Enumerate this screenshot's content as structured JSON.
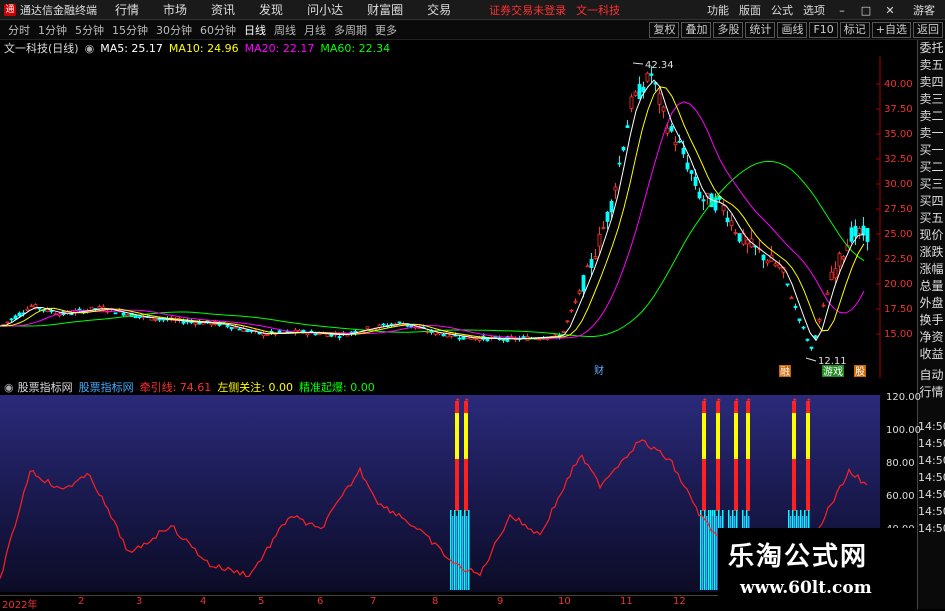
{
  "titlebar": {
    "app_title": "通达信金融终端",
    "menu": [
      "行情",
      "市场",
      "资讯",
      "发现",
      "问小达",
      "财富圈",
      "交易"
    ],
    "notice": "证券交易未登录",
    "stock_name": "文一科技",
    "right_menu": [
      "功能",
      "版面",
      "公式",
      "选项"
    ],
    "guest": "游客"
  },
  "periods": [
    "分时",
    "1分钟",
    "5分钟",
    "15分钟",
    "30分钟",
    "60分钟",
    "日线",
    "周线",
    "月线",
    "多周期",
    "更多"
  ],
  "active_period": "日线",
  "toolbar": [
    "复权",
    "叠加",
    "多股",
    "统计",
    "画线",
    "F10",
    "标记",
    "+自选",
    "返回"
  ],
  "ma": {
    "label": "文一科技(日线)",
    "ma5": "MA5: 25.17",
    "ma10": "MA10: 24.96",
    "ma20": "MA20: 22.17",
    "ma60": "MA60: 22.34"
  },
  "price_axis": [
    "40.00",
    "37.50",
    "35.00",
    "32.50",
    "30.00",
    "27.50",
    "25.00",
    "22.50",
    "20.00",
    "17.50",
    "15.00"
  ],
  "annotations": {
    "high": "42.34",
    "low": "12.11",
    "tags": [
      "财",
      "融",
      "游戏",
      "股"
    ]
  },
  "side_panel": [
    "委托",
    "卖五",
    "卖四",
    "卖三",
    "卖二",
    "卖一",
    "买一",
    "买二",
    "买三",
    "买四",
    "买五",
    "现价",
    "涨跌",
    "涨幅",
    "总量",
    "外盘",
    "换手",
    "净资",
    "收益",
    "自动",
    "行情"
  ],
  "sub_indicator": {
    "name": "股票指标网",
    "tag": "股票指标网",
    "line1": "牵引线: 74.61",
    "line2": "左侧关注: 0.00",
    "line3": "精准起爆: 0.00"
  },
  "sub_axis": [
    "120.00",
    "100.00",
    "80.00",
    "60.00",
    "40.00"
  ],
  "sub_axis_times": [
    "14:50",
    "14:50",
    "14:50",
    "14:50",
    "14:50",
    "14:50",
    "14:50"
  ],
  "xaxis": [
    "2022年",
    "2",
    "3",
    "4",
    "5",
    "6",
    "7",
    "8",
    "9",
    "10",
    "11",
    "12"
  ],
  "watermark": {
    "title": "乐淘公式网",
    "url": "www.60lt.com"
  },
  "colors": {
    "ma5": "#ffffff",
    "ma10": "#ffff00",
    "ma20": "#ff00ff",
    "ma60": "#00ff00",
    "up": "#ff3030",
    "down": "#00ffff",
    "traction_line": "#ff2020"
  }
}
